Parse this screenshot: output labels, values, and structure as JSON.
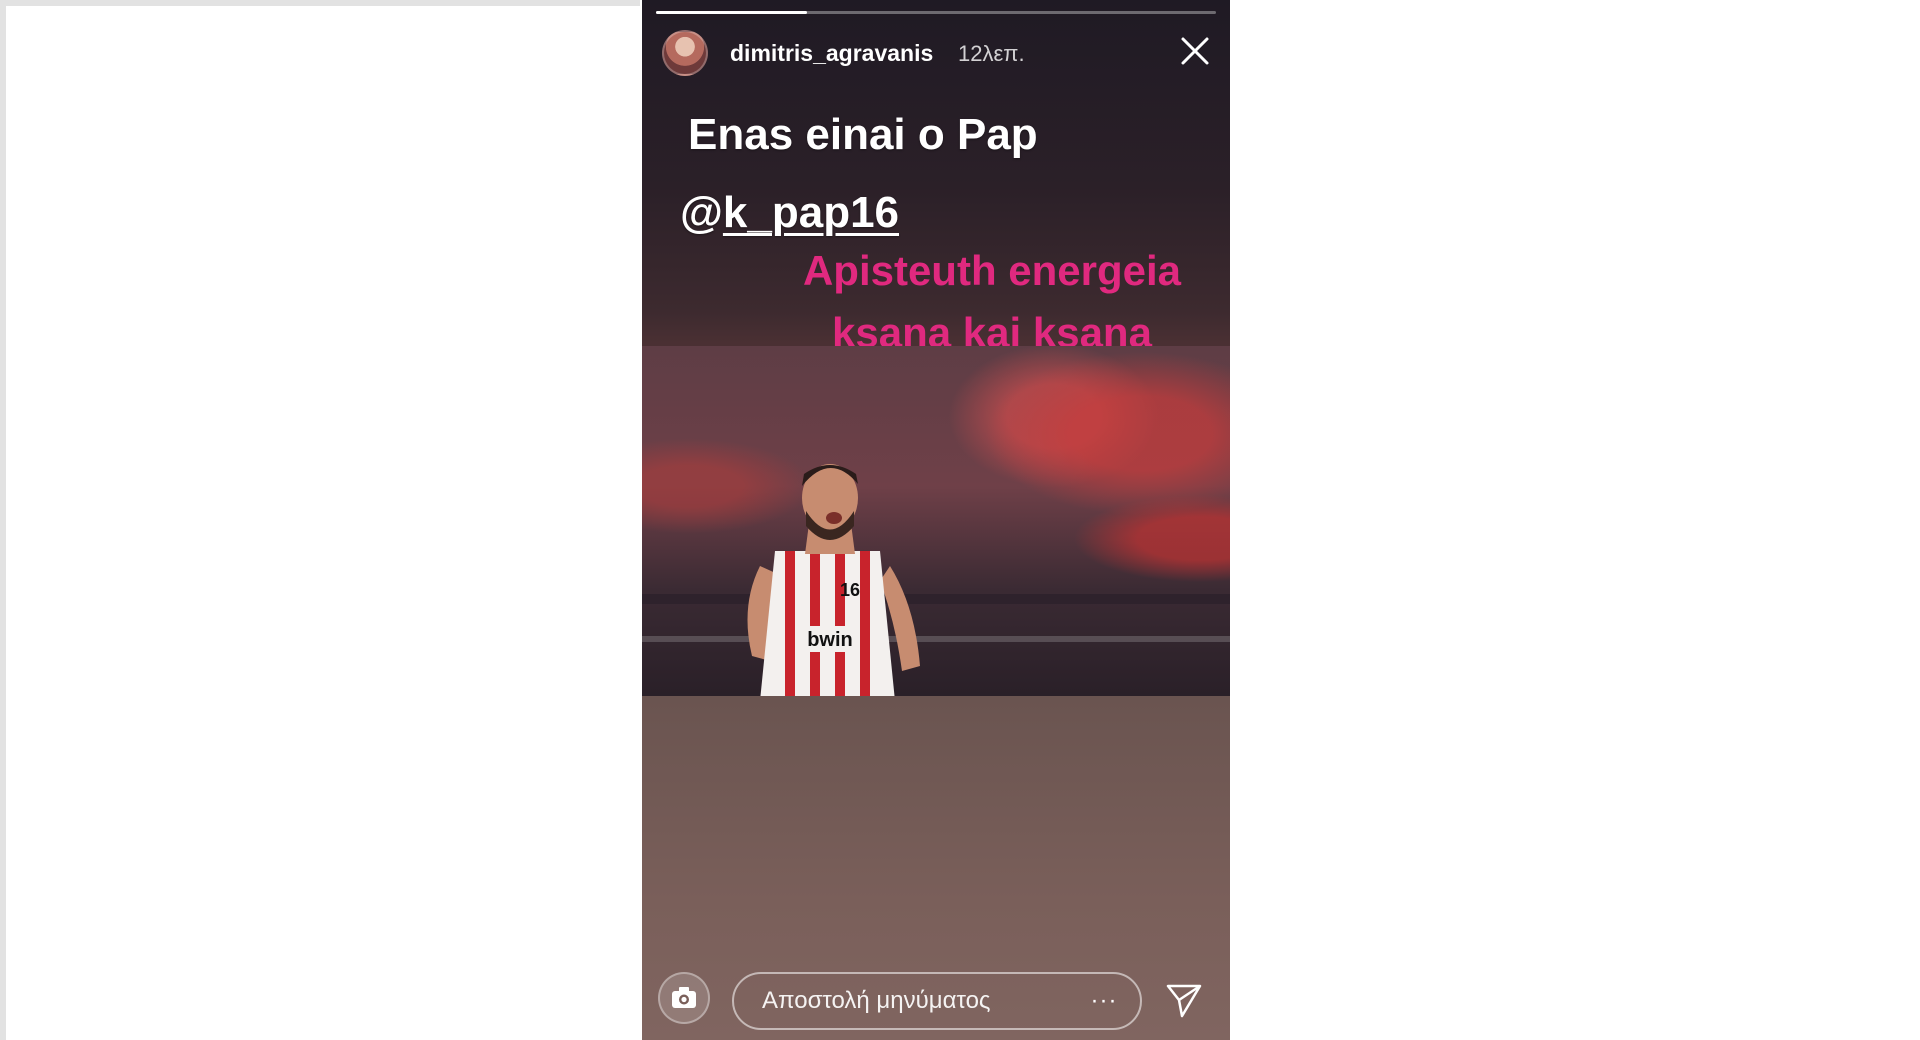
{
  "story": {
    "progress_fraction": 0.27,
    "header": {
      "username": "dimitris_agravanis",
      "time": "12λεπ.",
      "avatar_icon": "avatar",
      "close_icon": "close-icon"
    },
    "texts": {
      "main": "Enas einai o Pap",
      "mention_at": "@",
      "mention_handle": "k_pap16",
      "pink_line1": "Apisteuth energeia",
      "pink_line2": "ksana kai ksana"
    },
    "colors": {
      "pink": "#e0297f",
      "jersey_red": "#c8232c"
    },
    "photo": {
      "jersey_number": "16",
      "sponsor": "bwin"
    },
    "footer": {
      "camera_icon": "camera-icon",
      "message_placeholder": "Αποστολή μηνύματος",
      "more_label": "···",
      "send_icon": "send-icon"
    }
  }
}
